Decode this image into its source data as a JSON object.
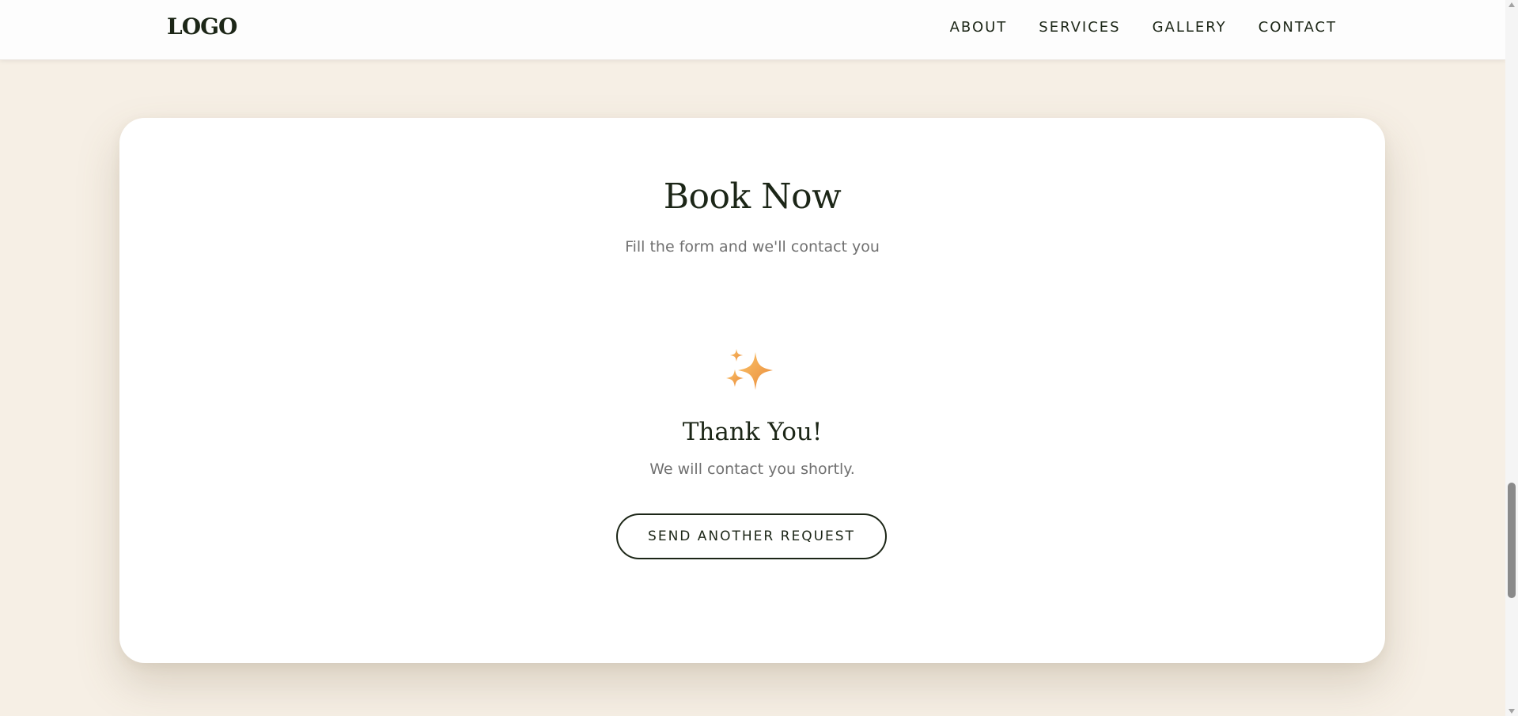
{
  "header": {
    "logo": "LOGO",
    "nav": [
      "ABOUT",
      "SERVICES",
      "GALLERY",
      "CONTACT"
    ]
  },
  "booking": {
    "title": "Book Now",
    "subtitle": "Fill the form and we'll contact you",
    "icon": "sparkles-icon",
    "success_title": "Thank You!",
    "success_message": "We will contact you shortly.",
    "button_label": "SEND ANOTHER REQUEST"
  },
  "colors": {
    "background": "#f6efe5",
    "text_dark": "#1c2617",
    "text_muted": "#707070",
    "sparkle": "#f2a94e"
  }
}
